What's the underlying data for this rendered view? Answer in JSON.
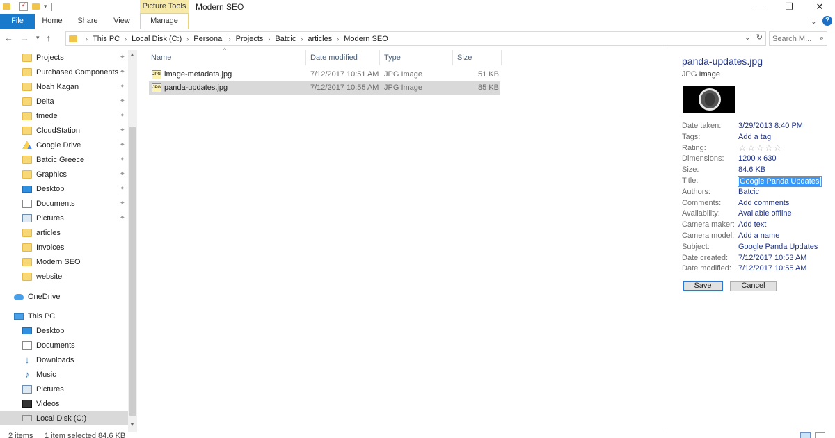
{
  "window": {
    "title": "Modern SEO",
    "context_tab_group": "Picture Tools"
  },
  "ribbon": {
    "tabs": [
      "File",
      "Home",
      "Share",
      "View",
      "Manage"
    ]
  },
  "address": {
    "crumbs": [
      "This PC",
      "Local Disk (C:)",
      "Personal",
      "Projects",
      "Batcic",
      "articles",
      "Modern SEO"
    ],
    "search_placeholder": "Search M..."
  },
  "nav": {
    "quick_access": [
      {
        "label": "Projects",
        "icon": "folder-icon",
        "pinned": true
      },
      {
        "label": "Purchased Components",
        "icon": "folder-icon",
        "pinned": true
      },
      {
        "label": "Noah Kagan",
        "icon": "folder-icon",
        "pinned": true
      },
      {
        "label": "Delta",
        "icon": "folder-icon",
        "pinned": true
      },
      {
        "label": "tmede",
        "icon": "folder-icon",
        "pinned": true
      },
      {
        "label": "CloudStation",
        "icon": "cloudstation-icon",
        "pinned": true
      },
      {
        "label": "Google Drive",
        "icon": "google-drive-icon",
        "pinned": true
      },
      {
        "label": "Batcic Greece",
        "icon": "folder-icon",
        "pinned": true
      },
      {
        "label": "Graphics",
        "icon": "folder-icon",
        "pinned": true
      },
      {
        "label": "Desktop",
        "icon": "desktop-icon",
        "pinned": true
      },
      {
        "label": "Documents",
        "icon": "documents-icon",
        "pinned": true
      },
      {
        "label": "Pictures",
        "icon": "pictures-icon",
        "pinned": true
      },
      {
        "label": "articles",
        "icon": "folder-icon",
        "pinned": false
      },
      {
        "label": "Invoices",
        "icon": "folder-icon",
        "pinned": false
      },
      {
        "label": "Modern SEO",
        "icon": "folder-icon",
        "pinned": false
      },
      {
        "label": "website",
        "icon": "folder-icon",
        "pinned": false
      }
    ],
    "onedrive": "OneDrive",
    "this_pc": "This PC",
    "this_pc_items": [
      {
        "label": "Desktop",
        "icon": "desktop-icon"
      },
      {
        "label": "Documents",
        "icon": "documents-icon"
      },
      {
        "label": "Downloads",
        "icon": "downloads-icon"
      },
      {
        "label": "Music",
        "icon": "music-icon"
      },
      {
        "label": "Pictures",
        "icon": "pictures-icon"
      },
      {
        "label": "Videos",
        "icon": "videos-icon"
      },
      {
        "label": "Local Disk (C:)",
        "icon": "local-disk-icon",
        "selected": true
      }
    ]
  },
  "filelist": {
    "columns": [
      "Name",
      "Date modified",
      "Type",
      "Size"
    ],
    "rows": [
      {
        "name": "image-metadata.jpg",
        "date": "7/12/2017 10:51 AM",
        "type": "JPG Image",
        "size": "51 KB",
        "selected": false
      },
      {
        "name": "panda-updates.jpg",
        "date": "7/12/2017 10:55 AM",
        "type": "JPG Image",
        "size": "85 KB",
        "selected": true
      }
    ]
  },
  "details": {
    "filename": "panda-updates.jpg",
    "filetype": "JPG Image",
    "rating_stars": 0,
    "props": [
      {
        "key": "Date taken:",
        "value": "3/29/2013 8:40 PM"
      },
      {
        "key": "Tags:",
        "value": "Add a tag"
      },
      {
        "key": "Rating:",
        "value": ""
      },
      {
        "key": "Dimensions:",
        "value": "1200 x 630"
      },
      {
        "key": "Size:",
        "value": "84.6 KB"
      },
      {
        "key": "Title:",
        "value": "Google Panda Updates"
      },
      {
        "key": "Authors:",
        "value": "Batcic"
      },
      {
        "key": "Comments:",
        "value": "Add comments"
      },
      {
        "key": "Availability:",
        "value": "Available offline"
      },
      {
        "key": "Camera maker:",
        "value": "Add text"
      },
      {
        "key": "Camera model:",
        "value": "Add a name"
      },
      {
        "key": "Subject:",
        "value": "Google Panda Updates"
      },
      {
        "key": "Date created:",
        "value": "7/12/2017 10:53 AM"
      },
      {
        "key": "Date modified:",
        "value": "7/12/2017 10:55 AM"
      }
    ],
    "save_label": "Save",
    "cancel_label": "Cancel"
  },
  "status": {
    "items": "2 items",
    "selection": "1 item selected  84.6 KB"
  },
  "colors": {
    "file_tab": "#1979ca",
    "context_tab": "#f7e9a7",
    "selection": "#d9d9d9",
    "link_value": "#1e3287"
  }
}
